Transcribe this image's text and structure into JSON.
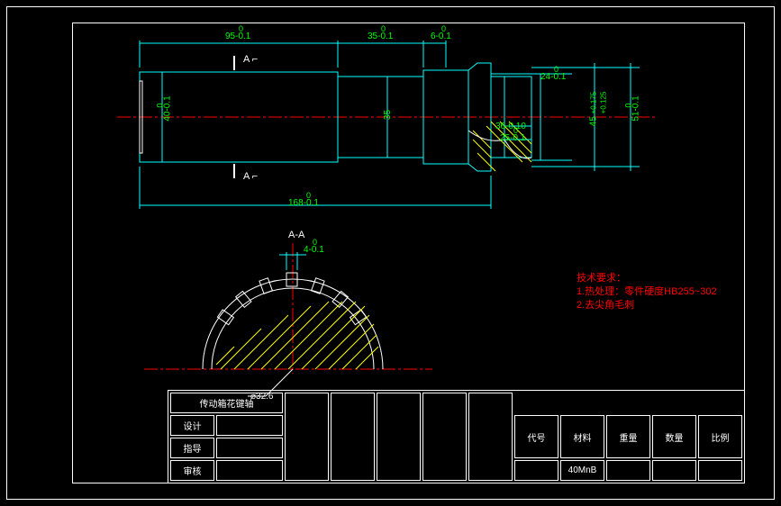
{
  "dimensions": {
    "d95": {
      "nom": "95",
      "tol_upper": "0",
      "tol_lower": "-0.1"
    },
    "d35": {
      "nom": "35",
      "tol_upper": "0",
      "tol_lower": "-0.1"
    },
    "d6": {
      "nom": "6",
      "tol_upper": "0",
      "tol_lower": "-0.1"
    },
    "d24": {
      "nom": "24",
      "tol_upper": "0",
      "tol_lower": "-0.1"
    },
    "d168": {
      "nom": "168",
      "tol_upper": "0",
      "tol_lower": "-0.1"
    },
    "d40": {
      "nom": "40",
      "tol_upper": "0",
      "tol_lower": "-0.1"
    },
    "d35v": {
      "nom": "35"
    },
    "d36": {
      "nom": "36",
      "tol_upper": "0",
      "tol_lower": "-0.10"
    },
    "d25": {
      "nom": "25",
      "tol_upper": "0",
      "tol_lower": "-0.1"
    },
    "d45": {
      "nom": "45",
      "tol_upper": "+0.175",
      "tol_lower": "+0.125"
    },
    "d51": {
      "nom": "51",
      "tol_upper": "0",
      "tol_lower": "-0.1"
    },
    "d4": {
      "nom": "4",
      "tol_upper": "0",
      "tol_lower": "-0.1"
    },
    "d326": {
      "nom": "⌀32.6"
    }
  },
  "section": {
    "marker": "A",
    "title": "A-A"
  },
  "tech_notes": {
    "title": "技术要求：",
    "line1": "1.热处理：零件硬度HB255~302",
    "line2": "2.去尖角毛刺"
  },
  "title_block": {
    "drawing_name": "传动箱花键轴",
    "design": "设计",
    "guide": "指导",
    "review": "审核",
    "code": "代号",
    "material": "材料",
    "material_val": "40MnB",
    "weight": "重量",
    "qty": "数量",
    "scale": "比例"
  }
}
